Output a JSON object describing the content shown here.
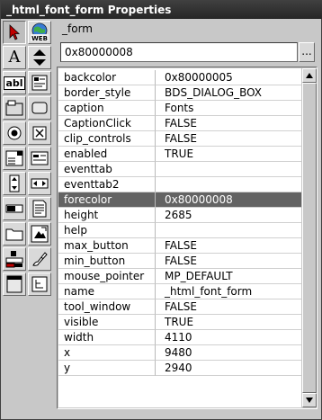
{
  "window": {
    "title": "_html_font_form Properties"
  },
  "object_name": "_form",
  "value_field": {
    "value": "0x80000008",
    "button_label": "..."
  },
  "properties": [
    {
      "name": "backcolor",
      "value": "0x80000005"
    },
    {
      "name": "border_style",
      "value": "BDS_DIALOG_BOX"
    },
    {
      "name": "caption",
      "value": "Fonts"
    },
    {
      "name": "CaptionClick",
      "value": "FALSE"
    },
    {
      "name": "clip_controls",
      "value": "FALSE"
    },
    {
      "name": "enabled",
      "value": "TRUE"
    },
    {
      "name": "eventtab",
      "value": ""
    },
    {
      "name": "eventtab2",
      "value": ""
    },
    {
      "name": "forecolor",
      "value": "0x80000008"
    },
    {
      "name": "height",
      "value": "2685"
    },
    {
      "name": "help",
      "value": ""
    },
    {
      "name": "max_button",
      "value": "FALSE"
    },
    {
      "name": "min_button",
      "value": "FALSE"
    },
    {
      "name": "mouse_pointer",
      "value": "MP_DEFAULT"
    },
    {
      "name": "name",
      "value": "_html_font_form"
    },
    {
      "name": "tool_window",
      "value": "FALSE"
    },
    {
      "name": "visible",
      "value": "TRUE"
    },
    {
      "name": "width",
      "value": "4110"
    },
    {
      "name": "x",
      "value": "9480"
    },
    {
      "name": "y",
      "value": "2940"
    }
  ],
  "selected_property": "forecolor",
  "toolbox": {
    "web_icon_text": "WEB",
    "text_tool_glyph": "A",
    "label_tool_text": "abl"
  },
  "colors": {
    "titlebar": "#2e2e2e",
    "selection": "#636363",
    "window": "#c8c8c8"
  }
}
